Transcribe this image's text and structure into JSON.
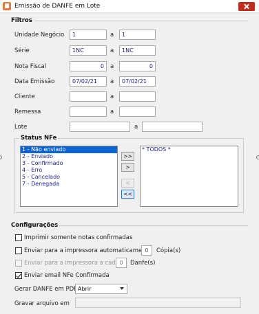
{
  "window": {
    "title": "Emissão de DANFE em Lote"
  },
  "filters": {
    "section_title": "Filtros",
    "a_label": "a",
    "rows": [
      {
        "label": "Unidade Negócio",
        "from": "1",
        "to": "1"
      },
      {
        "label": "Série",
        "from": "1NC",
        "to": "1NC"
      },
      {
        "label": "Nota Fiscal",
        "from": "0",
        "to": "0"
      },
      {
        "label": "Data Emissão",
        "from": "07/02/21",
        "to": "07/02/21"
      },
      {
        "label": "Cliente",
        "from": "",
        "to": ""
      },
      {
        "label": "Remessa",
        "from": "",
        "to": ""
      },
      {
        "label": "Lote",
        "from": "",
        "to": ""
      }
    ]
  },
  "status": {
    "section_title": "Status NFe",
    "available": [
      "1 - Não enviado",
      "2 - Enviado",
      "3 - Confirmado",
      "4 - Erro",
      "5 - Cancelado",
      "7 - Denegada"
    ],
    "selected": [
      "* TODOS *"
    ],
    "buttons": {
      "add_all": ">>",
      "add": ">",
      "remove": "<",
      "remove_all": "<<"
    }
  },
  "config": {
    "section_title": "Configurações",
    "print_confirmed": {
      "label": "Imprimir somente notas confirmadas",
      "checked": false
    },
    "send_printer_auto": {
      "label": "Enviar para a impressora automaticamente",
      "copies": "0",
      "copies_label": "Cópia(s)",
      "checked": false
    },
    "send_printer_every": {
      "label": "Enviar para a impressora a cada",
      "count": "0",
      "count_label": "Danfe(s)",
      "checked": false
    },
    "send_email": {
      "label": "Enviar email NFe Confirmada",
      "checked": true
    },
    "generate_pdf": {
      "label": "Gerar DANFE em PDF",
      "value": "Abrir"
    },
    "save_file": {
      "label": "Gravar arquivo em",
      "value": ""
    }
  }
}
